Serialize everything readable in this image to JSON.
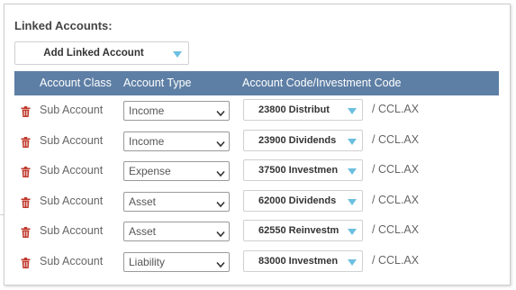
{
  "heading": "Linked Accounts:",
  "add_button": {
    "label": "Add Linked Account"
  },
  "table": {
    "headers": {
      "account_class": "Account Class",
      "account_type": "Account Type",
      "code": "Account Code/Investment Code"
    },
    "rows": [
      {
        "account_class": "Sub Account",
        "account_type": "Income",
        "code": "23800 Distribut",
        "suffix": "/ CCL.AX"
      },
      {
        "account_class": "Sub Account",
        "account_type": "Income",
        "code": "23900 Dividends",
        "suffix": "/ CCL.AX"
      },
      {
        "account_class": "Sub Account",
        "account_type": "Expense",
        "code": "37500 Investmen",
        "suffix": "/ CCL.AX"
      },
      {
        "account_class": "Sub Account",
        "account_type": "Asset",
        "code": "62000 Dividends",
        "suffix": "/ CCL.AX"
      },
      {
        "account_class": "Sub Account",
        "account_type": "Asset",
        "code": "62550 Reinvestm",
        "suffix": "/ CCL.AX"
      },
      {
        "account_class": "Sub Account",
        "account_type": "Liability",
        "code": "83000 Investmen",
        "suffix": "/ CCL.AX"
      }
    ]
  },
  "icons": {
    "delete": "trash-icon",
    "select": "chevron-down-icon",
    "dropdown": "caret-down-icon"
  },
  "colors": {
    "header_bg": "#5e7fa5",
    "trash": "#c0392b",
    "caret": "#6bbfe0"
  }
}
